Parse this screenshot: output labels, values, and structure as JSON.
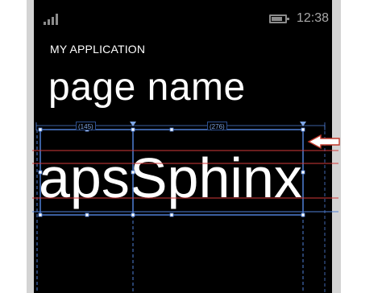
{
  "status_bar": {
    "time": "12:38",
    "signal_icon": "signal-strength-icon",
    "battery_icon": "battery-icon",
    "battery_level": 0.8
  },
  "app": {
    "title": "MY APPLICATION",
    "page_name": "page name"
  },
  "designer": {
    "column_widths": [
      "(145)",
      "(276)"
    ],
    "sample_text": "apsSphinx",
    "annotation_arrow_icon": "arrow-left-icon",
    "colors": {
      "guide_blue": "#4f7fd6",
      "baseline_red": "#d23a3a",
      "annotation_red": "#c0392b"
    }
  }
}
